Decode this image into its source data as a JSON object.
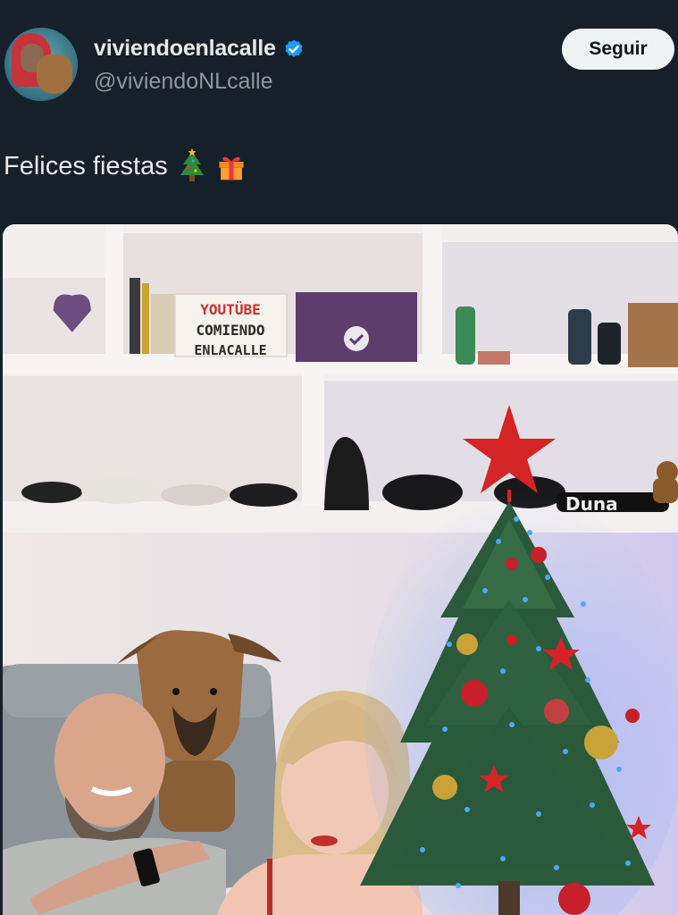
{
  "author": {
    "display_name": "viviendoenlacalle",
    "handle": "@viviendoNLcalle",
    "verified": true,
    "avatar_icon": "profile-avatar"
  },
  "follow_button": {
    "label": "Seguir"
  },
  "tweet": {
    "text": "Felices fiestas",
    "emojis": [
      "christmas-tree-icon",
      "gift-icon"
    ]
  },
  "photo": {
    "shelf_sign_line1": "YOUTÜBE",
    "shelf_sign_line2": "COMIENDO",
    "shelf_sign_line3": "ENLACALLE",
    "cap_text": "Duna"
  },
  "colors": {
    "background": "#15202b",
    "text": "#e7e9ea",
    "secondary_text": "#8b98a5",
    "verified_blue": "#1d9bf0",
    "button_bg": "#eff3f4"
  }
}
